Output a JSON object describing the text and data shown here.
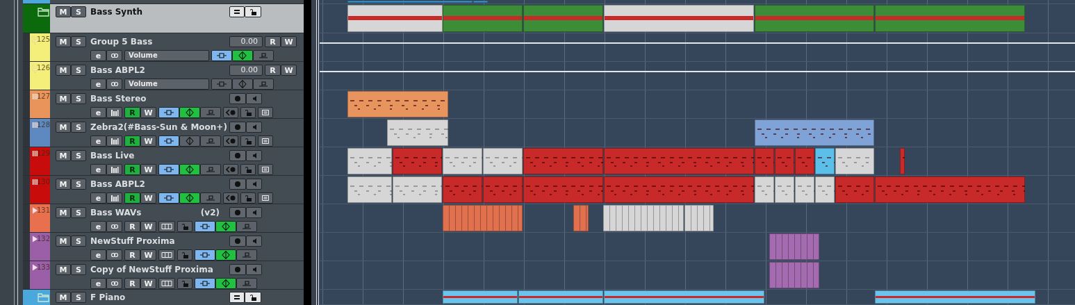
{
  "tracks": [
    {
      "kind": "partial",
      "color": "#4aa8dc",
      "parts": [
        {
          "color": "#3c9bd6"
        },
        {
          "color": "#3c9bd6"
        }
      ]
    },
    {
      "kind": "folder",
      "selected": true,
      "color": "#0b6a0b",
      "name": "Bass Synth",
      "mute": "M",
      "solo": "S",
      "parts": [
        {
          "color": "#d6d6d6"
        },
        {
          "color": "#3c8c38"
        },
        {
          "color": "#3c8c38"
        },
        {
          "color": "#d6d6d6"
        },
        {
          "color": "#3c8c38"
        },
        {
          "color": "#3c8c38"
        }
      ]
    },
    {
      "kind": "group",
      "selected": false,
      "color": "#f4ee7a",
      "number": "125",
      "name": "Group 5 Bass",
      "mute": "M",
      "solo": "S",
      "value": "0.00",
      "read": "R",
      "write": "W",
      "edit": "e",
      "param": "Volume",
      "auto_read_active": true,
      "auto_touch_active": true
    },
    {
      "kind": "group",
      "selected": false,
      "color": "#f4ee7a",
      "number": "126",
      "name": "Bass ABPL2",
      "mute": "M",
      "solo": "S",
      "value": "0.00",
      "read": "R",
      "write": "W",
      "edit": "e",
      "param": "Volume",
      "auto_read_active": false,
      "auto_touch_active": false
    },
    {
      "kind": "instrument",
      "selected": false,
      "color": "#e8945a",
      "number": "127",
      "name": "Bass Stereo",
      "mute": "M",
      "solo": "S",
      "read": "R",
      "write": "W",
      "edit": "e",
      "read_active": true,
      "auto_read_active": true,
      "auto_touch_active": true,
      "parts": [
        {
          "color": "#e8945e"
        }
      ]
    },
    {
      "kind": "instrument",
      "selected": false,
      "color": "#5e88c0",
      "number": "128",
      "name": "Zebra2(#Bass-Sun & Moon+)",
      "mute": "M",
      "solo": "S",
      "read": "R",
      "write": "W",
      "edit": "e",
      "read_active": true,
      "auto_read_active": true,
      "auto_touch_active": false,
      "parts": [
        {
          "color": "#d6d6d6"
        },
        {
          "color": "#7fa3d6"
        }
      ]
    },
    {
      "kind": "instrument",
      "selected": false,
      "color": "#c80c0c",
      "number": "129",
      "name": "Bass Live",
      "mute": "M",
      "solo": "S",
      "read": "R",
      "write": "W",
      "edit": "e",
      "read_active": true,
      "auto_read_active": true,
      "auto_touch_active": true,
      "parts": [
        {
          "color": "#d6d6d6"
        },
        {
          "color": "#c82a2a"
        },
        {
          "color": "#d6d6d6"
        },
        {
          "color": "#d6d6d6"
        },
        {
          "color": "#c82a2a"
        },
        {
          "color": "#c82a2a"
        },
        {
          "color": "#c82a2a"
        },
        {
          "color": "#c82a2a"
        },
        {
          "color": "#c82a2a"
        },
        {
          "color": "#5bbfea"
        },
        {
          "color": "#d6d6d6"
        },
        {
          "color": "#c82a2a"
        }
      ]
    },
    {
      "kind": "instrument",
      "selected": false,
      "color": "#c80c0c",
      "number": "130",
      "name": "Bass ABPL2",
      "mute": "M",
      "solo": "S",
      "read": "R",
      "write": "W",
      "edit": "e",
      "read_active": true,
      "auto_read_active": true,
      "auto_touch_active": true,
      "parts": [
        {
          "color": "#d6d6d6"
        },
        {
          "color": "#d6d6d6"
        },
        {
          "color": "#c82a2a"
        },
        {
          "color": "#c82a2a"
        },
        {
          "color": "#c82a2a"
        },
        {
          "color": "#c82a2a"
        },
        {
          "color": "#d6d6d6"
        },
        {
          "color": "#d6d6d6"
        },
        {
          "color": "#d6d6d6"
        },
        {
          "color": "#d6d6d6"
        },
        {
          "color": "#c82a2a"
        },
        {
          "color": "#c82a2a"
        }
      ]
    },
    {
      "kind": "audio",
      "selected": false,
      "color": "#e8704e",
      "number": "131",
      "name": "Bass WAVs",
      "suffix": "(v2)",
      "mute": "M",
      "solo": "S",
      "read": "R",
      "write": "W",
      "edit": "e",
      "read_active": false,
      "auto_read_active": true,
      "auto_touch_active": true,
      "parts": [
        {
          "color": "#e0704e"
        },
        {
          "color": "#e0704e"
        },
        {
          "color": "#d6d6d6"
        },
        {
          "color": "#d6d6d6"
        }
      ]
    },
    {
      "kind": "audio",
      "selected": false,
      "color": "#9a5fa6",
      "number": "132",
      "name": "NewStuff Proxima",
      "mute": "M",
      "solo": "S",
      "read": "R",
      "write": "W",
      "edit": "e",
      "read_active": false,
      "auto_read_active": true,
      "auto_touch_active": true,
      "parts": [
        {
          "color": "#a46bb0"
        }
      ]
    },
    {
      "kind": "audio",
      "selected": false,
      "color": "#9a5fa6",
      "number": "133",
      "name": "Copy of NewStuff Proxima",
      "mute": "M",
      "solo": "S",
      "read": "R",
      "write": "W",
      "edit": "e",
      "read_active": false,
      "auto_read_active": true,
      "auto_touch_active": true,
      "parts": [
        {
          "color": "#a46bb0"
        }
      ]
    },
    {
      "kind": "folder",
      "selected": false,
      "color": "#4aa8dc",
      "name": "F Piano",
      "mute": "M",
      "solo": "S",
      "parts": [
        {
          "color": "#6cc4ec"
        },
        {
          "color": "#6cc4ec"
        },
        {
          "color": "#6cc4ec"
        },
        {
          "color": "#6cc4ec"
        }
      ]
    }
  ]
}
